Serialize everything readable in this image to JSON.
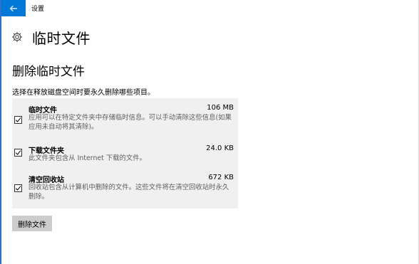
{
  "window": {
    "title": "设置",
    "back_icon": "arrow-left-icon",
    "accent": "#0078d7"
  },
  "page": {
    "icon": "gear-icon",
    "title": "临时文件",
    "section_title": "删除临时文件",
    "description": "选择在释放磁盘空间时要永久删除哪些项目。"
  },
  "items": [
    {
      "name": "临时文件",
      "size": "106 MB",
      "description": "应用可以在特定文件夹中存储临时信息。可以手动清除这些信息(如果应用未自动将其清除)。",
      "checked": true
    },
    {
      "name": "下载文件夹",
      "size": "24.0 KB",
      "description": "此文件夹包含从 Internet 下载的文件。",
      "checked": true
    },
    {
      "name": "清空回收站",
      "size": "672 KB",
      "description": "回收站包含从计算机中删除的文件。这些文件将在清空回收站时永久删除。",
      "checked": true
    }
  ],
  "actions": {
    "delete_label": "删除文件"
  }
}
